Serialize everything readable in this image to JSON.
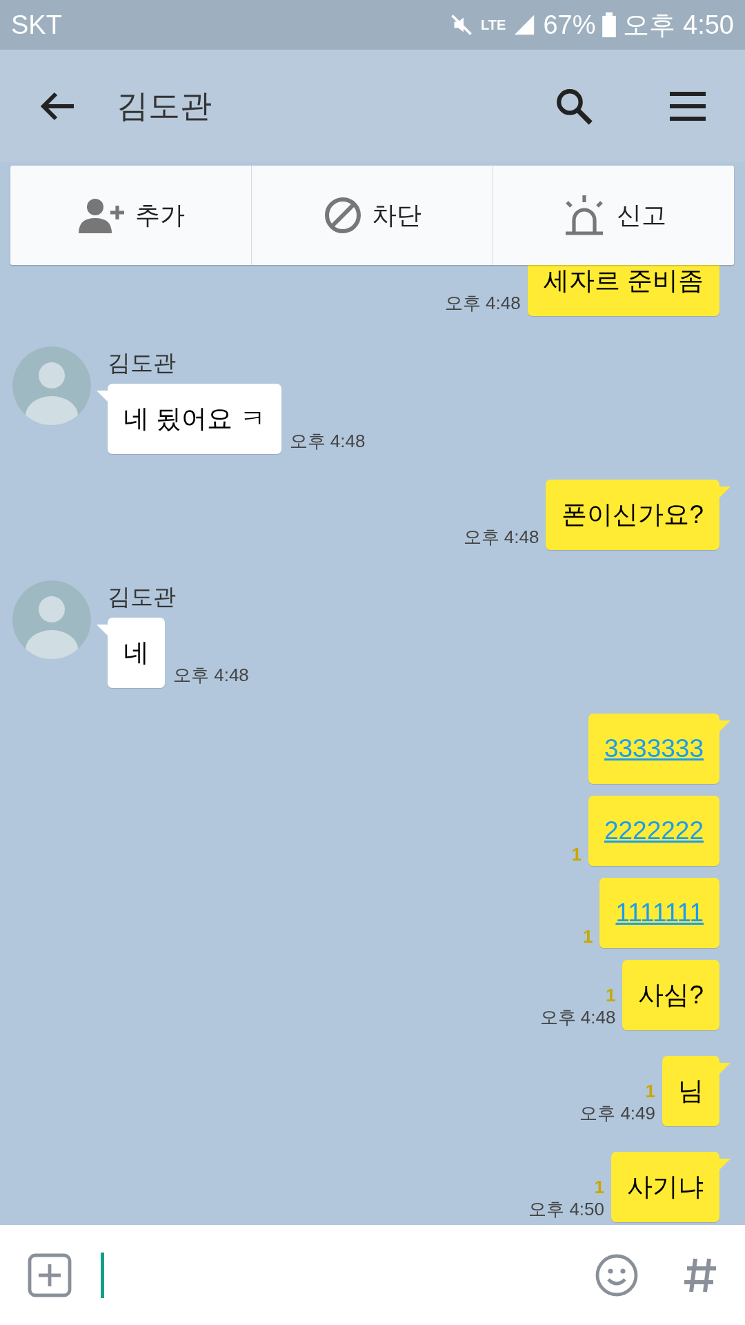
{
  "status_bar": {
    "carrier": "SKT",
    "network": "LTE",
    "battery": "67%",
    "time": "오후 4:50"
  },
  "header": {
    "title": "김도관"
  },
  "actions": [
    {
      "label": "추가",
      "kind": "add"
    },
    {
      "label": "차단",
      "kind": "block"
    },
    {
      "label": "신고",
      "kind": "report"
    }
  ],
  "messages": [
    {
      "kind": "outgoing",
      "text": "세자르 준비좀",
      "time": "오후 4:48",
      "tail": false,
      "link": false
    },
    {
      "kind": "incoming",
      "sender": "김도관",
      "text": "네 됬어요 ㅋ",
      "time": "오후 4:48",
      "tail": true,
      "link": false
    },
    {
      "kind": "outgoing",
      "text": "폰이신가요?",
      "time": "오후 4:48",
      "tail": true,
      "link": false
    },
    {
      "kind": "incoming",
      "sender": "김도관",
      "text": "네",
      "time": "오후 4:48",
      "tail": true,
      "link": false
    },
    {
      "kind": "outgoing",
      "text": "3333333",
      "tail": true,
      "link": true
    },
    {
      "kind": "outgoing",
      "text": "2222222",
      "unread": "1",
      "tail": false,
      "link": true
    },
    {
      "kind": "outgoing",
      "text": "1111111",
      "unread": "1",
      "tail": false,
      "link": true
    },
    {
      "kind": "outgoing",
      "text": "사심?",
      "unread": "1",
      "time": "오후 4:48",
      "tail": false,
      "link": false
    },
    {
      "kind": "outgoing",
      "text": "님",
      "unread": "1",
      "time": "오후 4:49",
      "tail": true,
      "link": false
    },
    {
      "kind": "outgoing",
      "text": "사기냐",
      "unread": "1",
      "time": "오후 4:50",
      "tail": true,
      "link": false
    }
  ]
}
